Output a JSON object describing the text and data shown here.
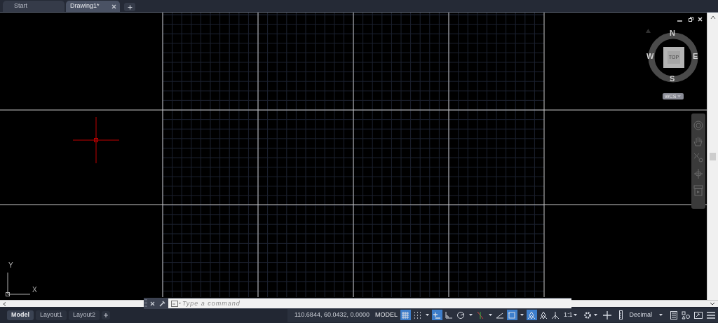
{
  "file_tabs": [
    {
      "label": "Start",
      "selected": false
    },
    {
      "label": "Drawing1*",
      "selected": true
    }
  ],
  "viewcube": {
    "face": "TOP",
    "north": "N",
    "south": "S",
    "east": "E",
    "west": "W",
    "coordinate_system": "WCS"
  },
  "ucs_icon": {
    "x_label": "X",
    "y_label": "Y"
  },
  "command_line": {
    "placeholder": "Type a command"
  },
  "layout_tabs": [
    {
      "label": "Model",
      "selected": true
    },
    {
      "label": "Layout1",
      "selected": false
    },
    {
      "label": "Layout2",
      "selected": false
    }
  ],
  "status_bar": {
    "coordinates": "110.6844, 60.0432, 0.0000",
    "space": "MODEL",
    "toggles": [
      {
        "selected": true
      },
      {
        "selected": false
      },
      {
        "selected": true
      },
      {
        "selected": false
      },
      {
        "selected": false
      },
      {
        "selected": false
      },
      {
        "selected": false
      },
      {
        "selected": true
      },
      {
        "selected": true
      },
      {
        "selected": false
      },
      {
        "selected": false
      }
    ],
    "scale": "1:1",
    "units": "Decimal"
  }
}
